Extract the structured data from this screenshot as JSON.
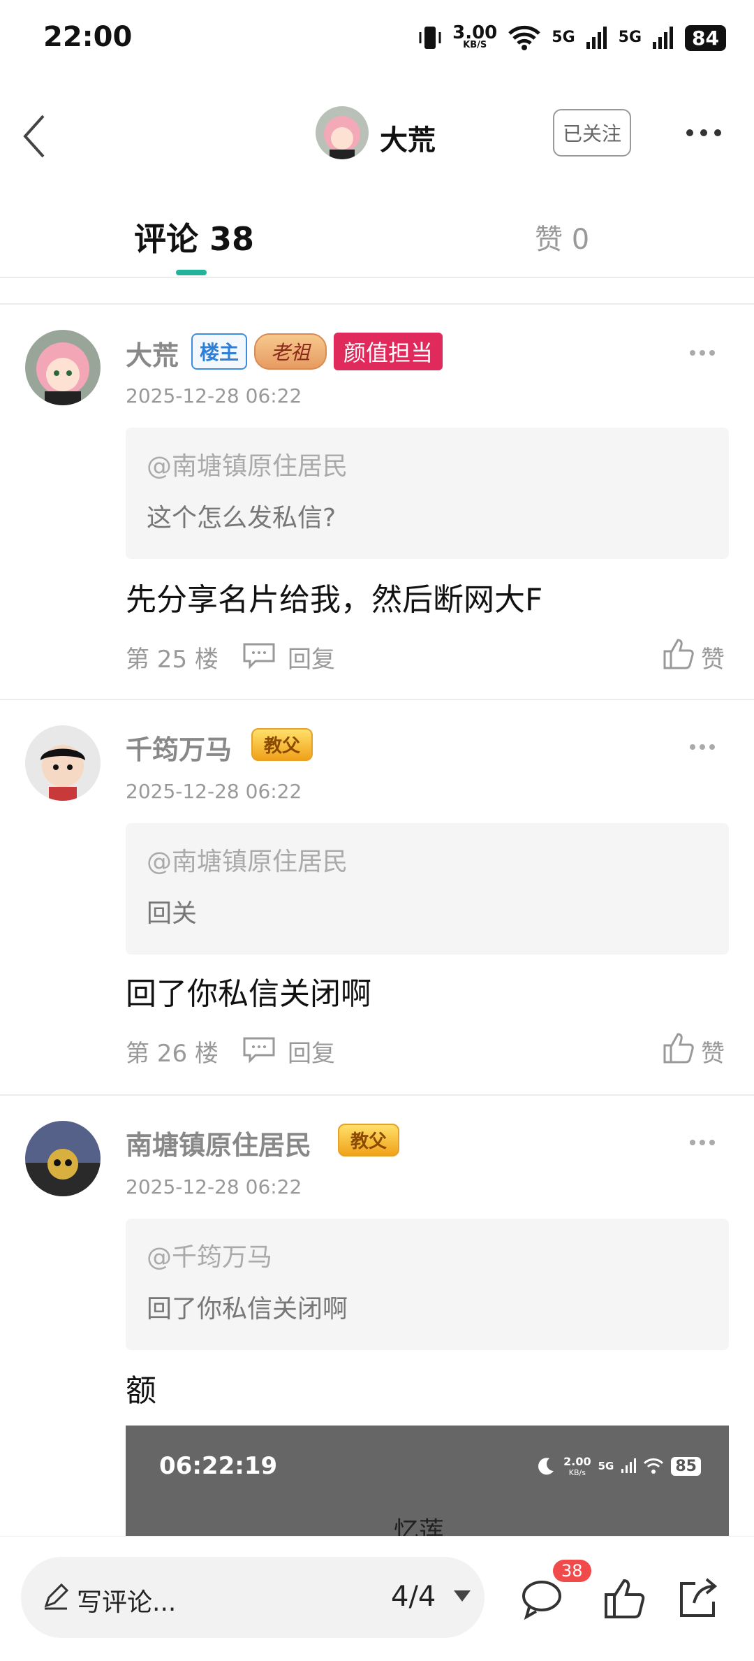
{
  "status_bar": {
    "time": "22:00",
    "speed_value": "3.00",
    "speed_unit": "KB/S",
    "net1": "5G",
    "net2": "5G",
    "battery": "84"
  },
  "header": {
    "title": "大荒",
    "follow_label": "已关注"
  },
  "tabs": {
    "comments_label": "评论 38",
    "likes_label": "赞 0"
  },
  "comments": [
    {
      "author": "大荒",
      "badges": [
        "楼主",
        "老祖",
        "颜值担当"
      ],
      "time": "2025-12-28 06:22",
      "quote_at": "@南塘镇原住居民",
      "quote_text": "这个怎么发私信?",
      "content": "先分享名片给我，然后断网大F",
      "floor": "第 25 楼",
      "reply_label": "回复",
      "like_label": "赞"
    },
    {
      "author": "千筠万马",
      "badges": [
        "教父"
      ],
      "time": "2025-12-28 06:22",
      "quote_at": "@南塘镇原住居民",
      "quote_text": "回关",
      "content": "回了你私信关闭啊",
      "floor": "第 26 楼",
      "reply_label": "回复",
      "like_label": "赞"
    },
    {
      "author": "南塘镇原住居民",
      "badges": [
        "教父"
      ],
      "time": "2025-12-28 06:22",
      "quote_at": "@千筠万马",
      "quote_text": "回了你私信关闭啊",
      "content": "额",
      "screenshot": {
        "time": "06:22:19",
        "speed_value": "2.00",
        "speed_unit": "KB/s",
        "net": "5G",
        "battery": "85",
        "title": "忆莲"
      }
    }
  ],
  "bottom_bar": {
    "input_placeholder": "写评论...",
    "page_indicator": "4/4",
    "comment_count": "38"
  },
  "colors": {
    "accent": "#23b39a",
    "badge_owner": "#2d7fd7",
    "badge_looks": "#e02a5c",
    "notification": "#f04a4a"
  }
}
